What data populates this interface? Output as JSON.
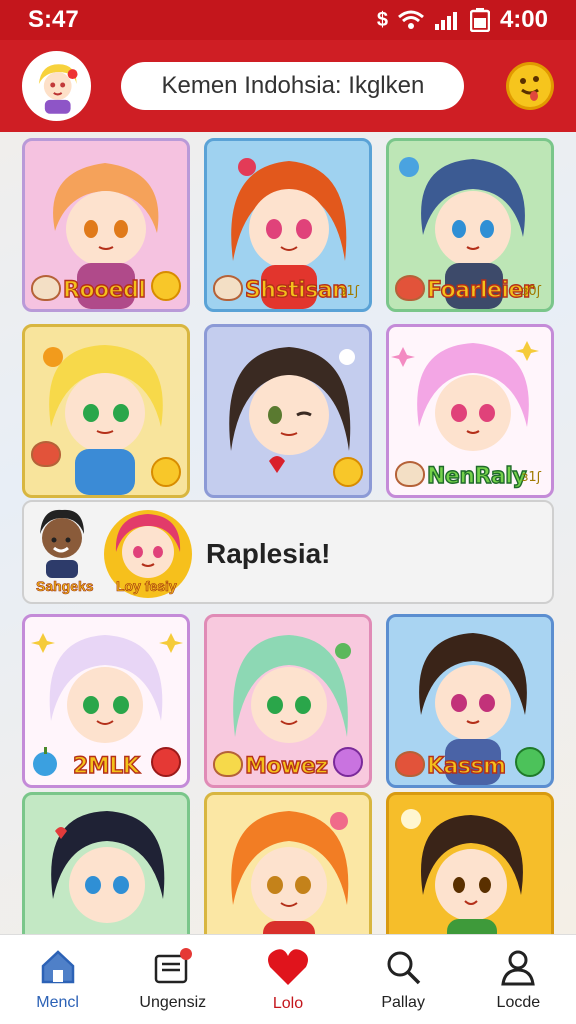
{
  "status_bar": {
    "time": "S:47",
    "clock": "4:00",
    "icons": [
      "dollar-icon",
      "wifi-icon",
      "signal-icon",
      "battery-icon"
    ]
  },
  "header": {
    "search_text": "Kemen Indohsia: Ikglken",
    "avatar": "avatar",
    "emoji": "smiley-icon"
  },
  "cards": [
    {
      "name": "Rooedl",
      "name_style": "gold"
    },
    {
      "name": "Shstisan",
      "name_style": "gold"
    },
    {
      "name": "Foarleier",
      "name_style": "gold"
    },
    {
      "name": "",
      "name_style": "gold"
    },
    {
      "name": "",
      "name_style": "gold"
    },
    {
      "name": "NenRaly",
      "name_style": "green"
    },
    {
      "name": "2MLK",
      "name_style": "gold"
    },
    {
      "name": "Mowez",
      "name_style": "gold"
    },
    {
      "name": "Kassm",
      "name_style": "gold"
    }
  ],
  "tags": {
    "c2": "ɜ1ʃ",
    "c3": "ɜ0ʃ",
    "c6": "ɜ1ʃ"
  },
  "banner": {
    "text": "Raplesia!",
    "label_left": "Sahgeks",
    "label_right": "Loy fesiy"
  },
  "bottom_nav": [
    {
      "label": "Mencl",
      "icon": "home-icon"
    },
    {
      "label": "Ungensiz",
      "icon": "inbox-icon"
    },
    {
      "label": "Lolo",
      "icon": "heart-icon"
    },
    {
      "label": "Pallay",
      "icon": "search-icon"
    },
    {
      "label": "Locde",
      "icon": "profile-icon"
    }
  ],
  "colors": {
    "primary_red": "#c4161c",
    "home_blue": "#2c62b6",
    "badge_red": "#e53935"
  }
}
